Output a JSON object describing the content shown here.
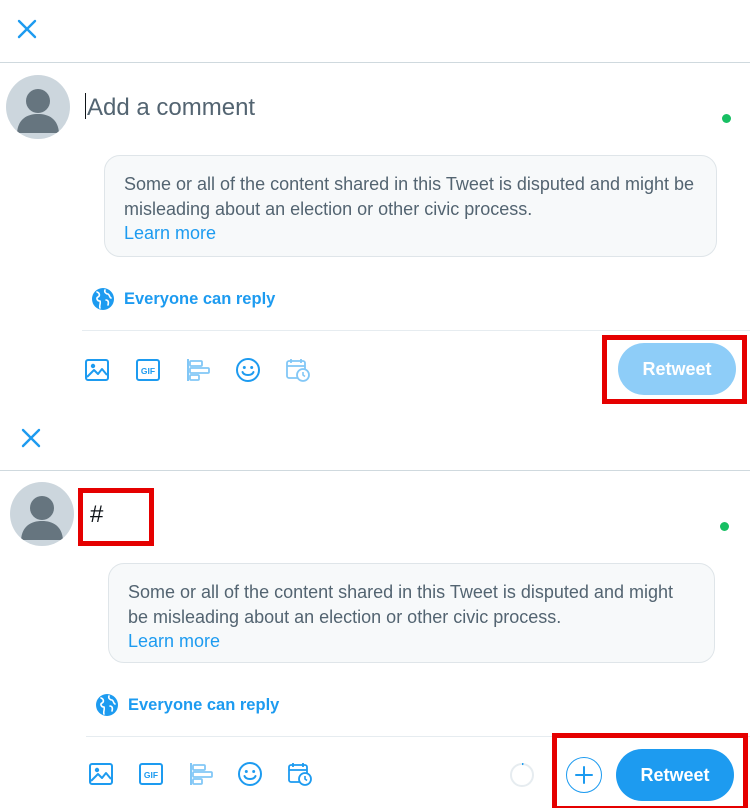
{
  "colors": {
    "accent": "#1d9bf0",
    "accent_disabled": "#8ecdf8",
    "highlight": "#e50000",
    "online": "#17bf63"
  },
  "panel_a": {
    "composer": {
      "placeholder": "Add a comment"
    },
    "notice": {
      "text": "Some or all of the content shared in this Tweet is disputed and might be misleading about an election or other civic process.",
      "link": "Learn more"
    },
    "reply_setting": "Everyone can reply",
    "retweet_button": {
      "label": "Retweet",
      "state": "disabled"
    },
    "toolbar_icons": [
      "image-icon",
      "gif-icon",
      "poll-icon",
      "emoji-icon",
      "schedule-icon"
    ]
  },
  "panel_b": {
    "composer": {
      "text": "#"
    },
    "notice": {
      "text": "Some or all of the content shared in this Tweet is disputed and might be misleading about an election or other civic process.",
      "link": "Learn more"
    },
    "reply_setting": "Everyone can reply",
    "retweet_button": {
      "label": "Retweet",
      "state": "enabled"
    },
    "toolbar_icons": [
      "image-icon",
      "gif-icon",
      "poll-icon",
      "emoji-icon",
      "schedule-icon"
    ],
    "extra_controls": [
      "character-progress-ring",
      "add-thread-button"
    ]
  }
}
